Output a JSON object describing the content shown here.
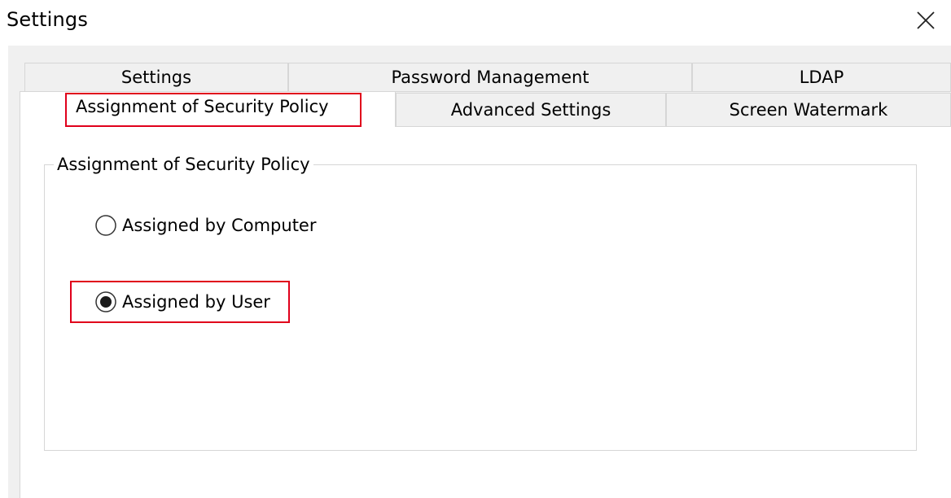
{
  "window": {
    "title": "Settings",
    "close_icon": "close-icon"
  },
  "tabs": {
    "row_back": [
      {
        "label": "Settings"
      },
      {
        "label": "Password Management"
      },
      {
        "label": "LDAP"
      }
    ],
    "row_front": [
      {
        "label": "Assignment of Security Policy",
        "selected": true
      },
      {
        "label": "Advanced Settings"
      },
      {
        "label": "Screen Watermark"
      }
    ]
  },
  "group": {
    "legend": "Assignment of Security Policy",
    "options": [
      {
        "label": "Assigned by Computer",
        "checked": false
      },
      {
        "label": "Assigned by User",
        "checked": true
      }
    ]
  },
  "colors": {
    "highlight": "#e0001b",
    "tab_background": "#f0f0f0",
    "border": "#d6d6d6"
  }
}
